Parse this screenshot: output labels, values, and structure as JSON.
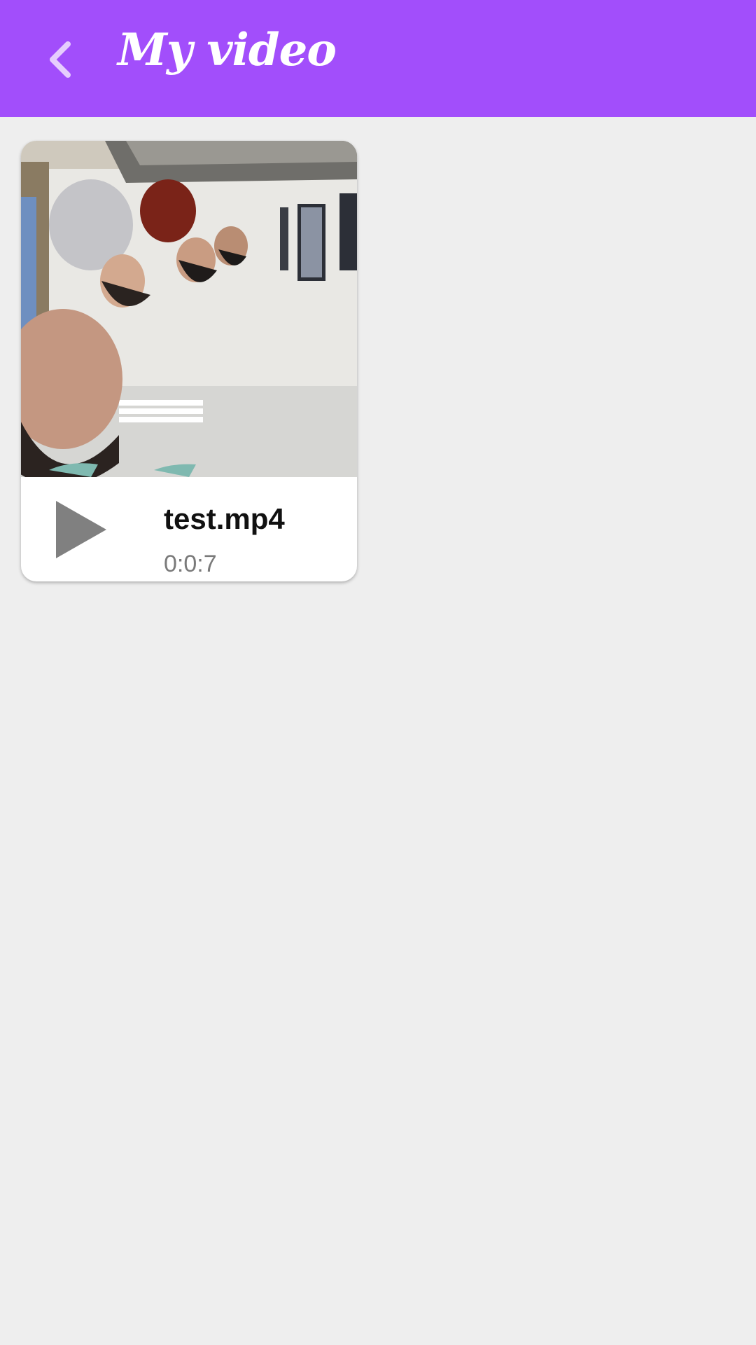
{
  "app_bar": {
    "title": "My video",
    "back_icon": "chevron-left-icon",
    "background_color": "#a24efb"
  },
  "videos": [
    {
      "name": "test.mp4",
      "duration": "0:0:7",
      "thumbnail": "video-thumbnail",
      "play_icon": "play-icon"
    }
  ]
}
